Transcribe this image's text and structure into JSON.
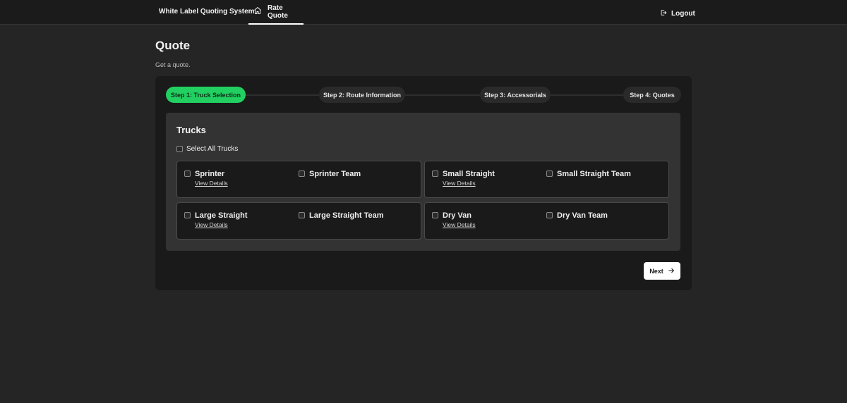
{
  "nav": {
    "brand": "White Label Quoting System",
    "tab_label": "Rate Quote",
    "tab_icon": "home-icon",
    "logout_label": "Logout",
    "logout_icon": "logout-icon"
  },
  "page": {
    "title": "Quote",
    "subtitle": "Get a quote."
  },
  "stepper": {
    "active_color": "#22d062",
    "steps": [
      {
        "label": "Step 1: Truck Selection",
        "active": true
      },
      {
        "label": "Step 2: Route Information",
        "active": false
      },
      {
        "label": "Step 3: Accessorials",
        "active": false
      },
      {
        "label": "Step 4: Quotes",
        "active": false
      }
    ]
  },
  "trucks": {
    "title": "Trucks",
    "select_all_label": "Select All Trucks",
    "view_details_label": "View Details",
    "groups": [
      {
        "primary": "Sprinter",
        "team": "Sprinter Team"
      },
      {
        "primary": "Small Straight",
        "team": "Small Straight Team"
      },
      {
        "primary": "Large Straight",
        "team": "Large Straight Team"
      },
      {
        "primary": "Dry Van",
        "team": "Dry Van Team"
      }
    ]
  },
  "actions": {
    "next_label": "Next",
    "next_icon": "arrow-right-icon"
  }
}
